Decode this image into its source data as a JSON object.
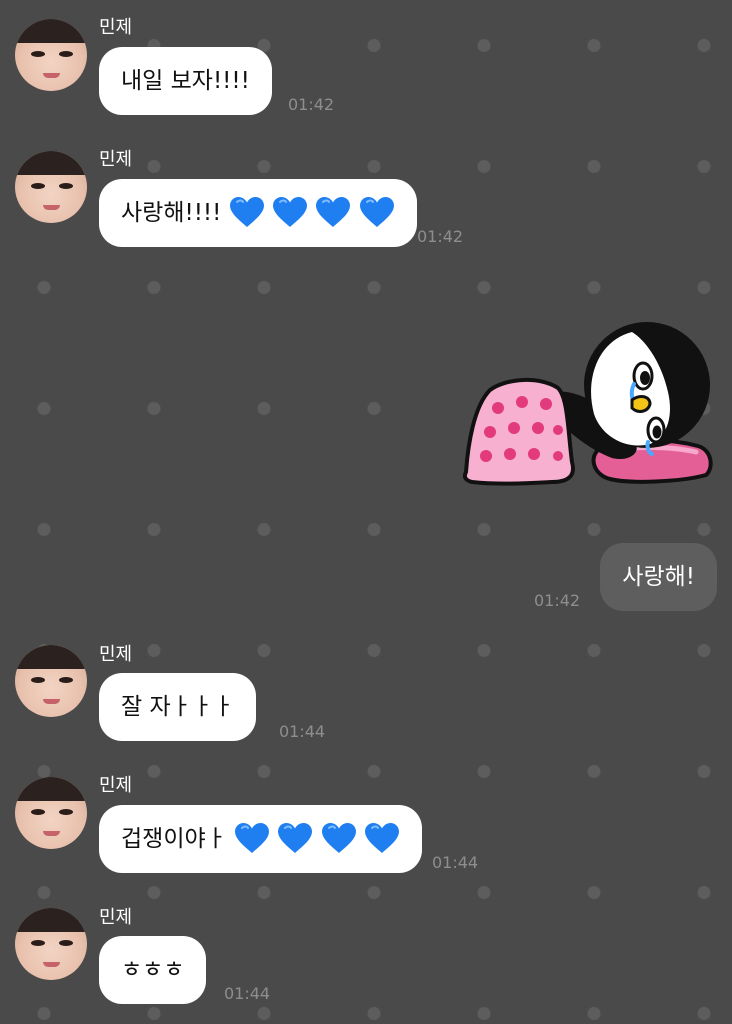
{
  "sender": "민제",
  "messages": [
    {
      "from": "other",
      "text": "내일 보자!!!!",
      "hearts": 0,
      "time": "01:42"
    },
    {
      "from": "other",
      "text": "사랑해!!!!",
      "hearts": 4,
      "time": "01:42"
    },
    {
      "from": "me",
      "type": "sticker",
      "sticker": "penguin-crying-under-pink-polka-dot-blanket"
    },
    {
      "from": "me",
      "text": "사랑해!",
      "time": "01:42"
    },
    {
      "from": "other",
      "text": "잘 자ㅏㅏㅏ",
      "hearts": 0,
      "time": "01:44"
    },
    {
      "from": "other",
      "text": "겁쟁이야ㅏ",
      "hearts": 4,
      "time": "01:44"
    },
    {
      "from": "other",
      "text": "ㅎㅎㅎ",
      "hearts": 0,
      "time": "01:44"
    }
  ],
  "colors": {
    "background": "#4a4a4a",
    "dot": "#5d5d5d",
    "bubble_other": "#ffffff",
    "bubble_mine": "#5e5e5e",
    "heart": "#1f7ff0",
    "timestamp": "#8e8e8e"
  }
}
